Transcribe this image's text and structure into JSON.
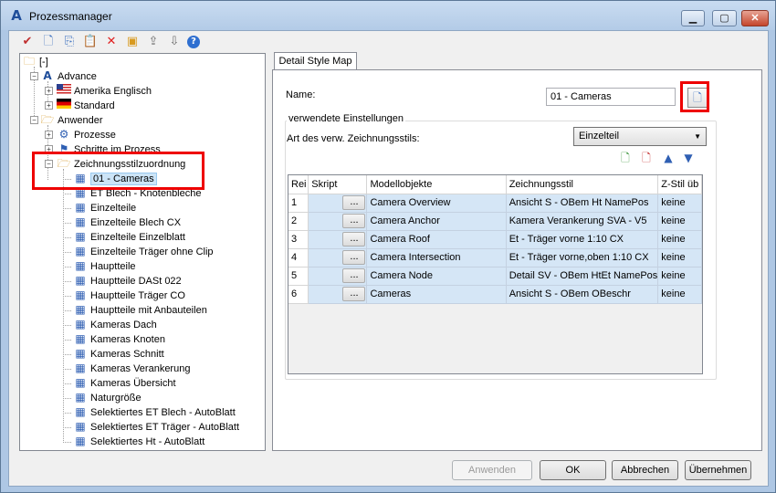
{
  "window": {
    "title": "Prozessmanager",
    "minimize": "▁",
    "maximize": "▢",
    "close": "✕"
  },
  "toolbar": [
    {
      "name": "check-icon",
      "glyph": "✔",
      "color": "#c03030"
    },
    {
      "name": "new-doc-icon",
      "glyph": "🗋",
      "color": "#3a6fbf"
    },
    {
      "name": "copy-icon",
      "glyph": "⎘",
      "color": "#3a6fbf"
    },
    {
      "name": "paste-icon",
      "glyph": "📋",
      "color": "#3a6fbf"
    },
    {
      "name": "delete-icon",
      "glyph": "✕",
      "color": "#e02020"
    },
    {
      "name": "monitor-icon",
      "glyph": "▣",
      "color": "#d89a20"
    },
    {
      "name": "export-icon",
      "glyph": "⇪",
      "color": "#6f6f6f"
    },
    {
      "name": "import-icon",
      "glyph": "⇩",
      "color": "#6f6f6f"
    },
    {
      "name": "help-icon",
      "glyph": "?",
      "color": "#ffffff"
    }
  ],
  "tree": {
    "root": "[-]",
    "advance": "Advance",
    "amerika": "Amerika Englisch",
    "standard": "Standard",
    "anwender": "Anwender",
    "prozesse": "Prozesse",
    "schritte": "Schritte im Prozess",
    "zuordnung": "Zeichnungsstilzuordnung",
    "children": [
      "01 - Cameras",
      "ET Blech - Knotenbleche",
      "Einzelteile",
      "Einzelteile Blech CX",
      "Einzelteile Einzelblatt",
      "Einzelteile Träger ohne Clip",
      "Hauptteile",
      "Hauptteile DASt 022",
      "Hauptteile Träger CO",
      "Hauptteile mit Anbauteilen",
      "Kameras Dach",
      "Kameras Knoten",
      "Kameras Schnitt",
      "Kameras Verankerung",
      "Kameras Übersicht",
      "Naturgröße",
      "Selektiertes ET Blech - AutoBlatt",
      "Selektiertes ET Träger - AutoBlatt",
      "Selektiertes Ht - AutoBlatt"
    ]
  },
  "tab": {
    "label": "Detail Style Map"
  },
  "form": {
    "name_label": "Name:",
    "name_value": "01 - Cameras",
    "group_label": "verwendete Einstellungen",
    "art_label": "Art des verw. Zeichnungsstils:",
    "art_value": "Einzelteil"
  },
  "grid": {
    "headers": [
      "Rei",
      "Skript",
      "Modellobjekte",
      "Zeichnungsstil",
      "Z-Stil üb"
    ],
    "button_label": "...",
    "rows": [
      {
        "n": "1",
        "model": "Camera Overview",
        "style": "Ansicht S - OBem Ht NamePos",
        "z": "keine"
      },
      {
        "n": "2",
        "model": "Camera Anchor",
        "style": "Kamera Verankerung SVA - V5",
        "z": "keine"
      },
      {
        "n": "3",
        "model": "Camera Roof",
        "style": "Et - Träger vorne 1:10 CX",
        "z": "keine"
      },
      {
        "n": "4",
        "model": "Camera Intersection",
        "style": "Et - Träger vorne,oben 1:10 CX",
        "z": "keine"
      },
      {
        "n": "5",
        "model": "Camera Node",
        "style": "Detail SV - OBem HtEt NamePos",
        "z": "keine"
      },
      {
        "n": "6",
        "model": "Cameras",
        "style": "Ansicht S - OBem OBeschr",
        "z": "keine"
      }
    ]
  },
  "buttons": {
    "apply": "Anwenden",
    "ok": "OK",
    "cancel": "Abbrechen",
    "accept": "Übernehmen"
  },
  "colors": {
    "highlight_red": "#e00000",
    "row_bg": "#d5e6f6",
    "titlebar": "#b9d0ea"
  }
}
